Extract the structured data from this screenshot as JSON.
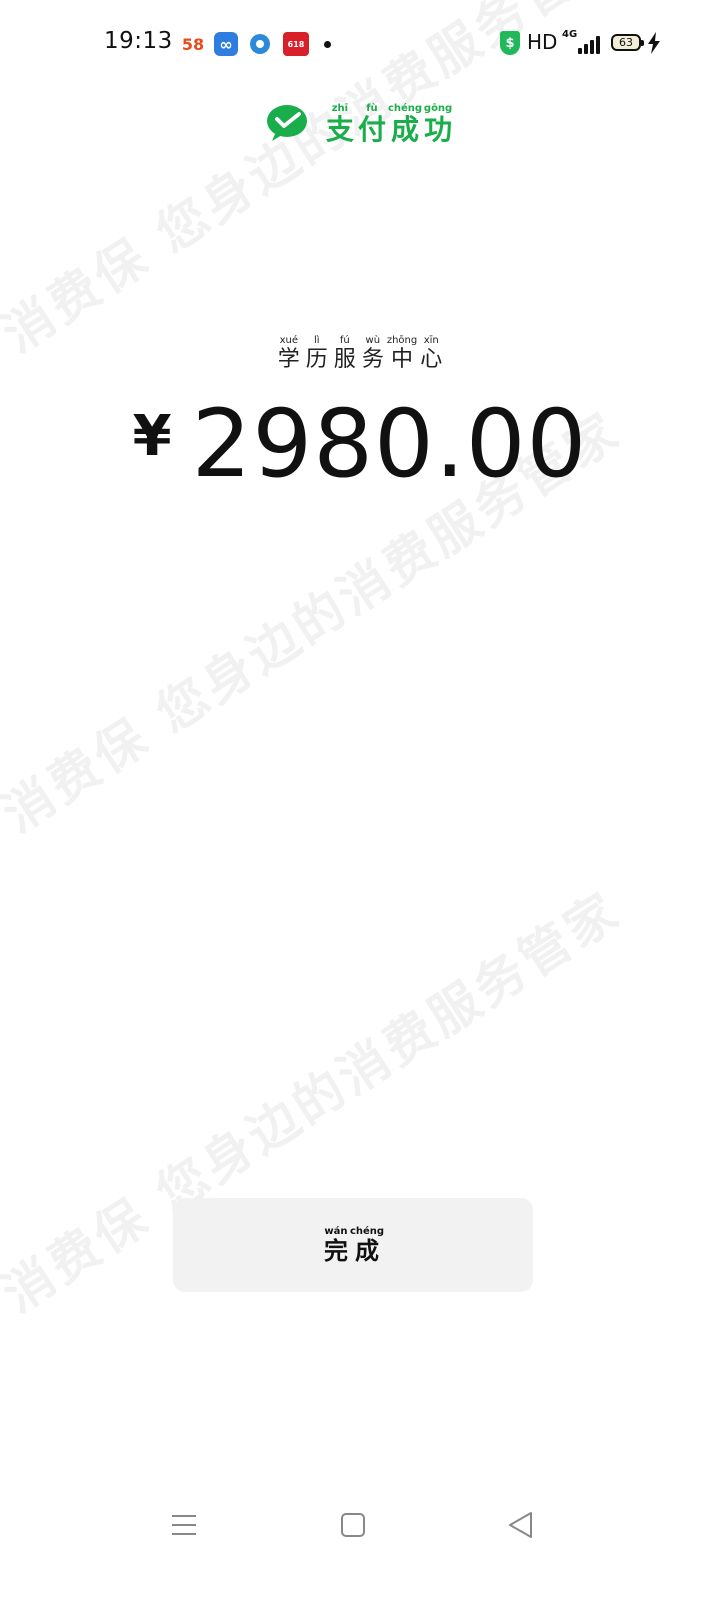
{
  "status_bar": {
    "time": "19:13",
    "notification_icons": [
      "58-app-icon",
      "infinity-app-icon",
      "circle-app-icon",
      "618-app-icon"
    ],
    "app_58_label": "58",
    "app_618_label": "618",
    "hd_label": "HD",
    "network_label": "4G",
    "battery_level": "63"
  },
  "header": {
    "title_chars": [
      {
        "hz": "支",
        "py": "zhī"
      },
      {
        "hz": "付",
        "py": "fù"
      },
      {
        "hz": "成",
        "py": "chéng"
      },
      {
        "hz": "功",
        "py": "gōng"
      }
    ]
  },
  "merchant": {
    "chars": [
      {
        "hz": "学",
        "py": "xué"
      },
      {
        "hz": "历",
        "py": "lì"
      },
      {
        "hz": "服",
        "py": "fú"
      },
      {
        "hz": "务",
        "py": "wù"
      },
      {
        "hz": "中",
        "py": "zhōng"
      },
      {
        "hz": "心",
        "py": "xīn"
      }
    ]
  },
  "payment": {
    "currency": "¥",
    "amount": "2980.00"
  },
  "done_button": {
    "chars": [
      {
        "hz": "完",
        "py": "wán"
      },
      {
        "hz": "成",
        "py": "chéng"
      }
    ]
  },
  "watermark": {
    "text": "消费保 您身边的消费服务管家"
  },
  "colors": {
    "brand_green": "#1aad4b",
    "button_bg": "#f2f2f2",
    "text_dark": "#111111"
  },
  "nav_bar": {
    "icons": [
      "menu-icon",
      "home-icon",
      "back-icon"
    ]
  }
}
